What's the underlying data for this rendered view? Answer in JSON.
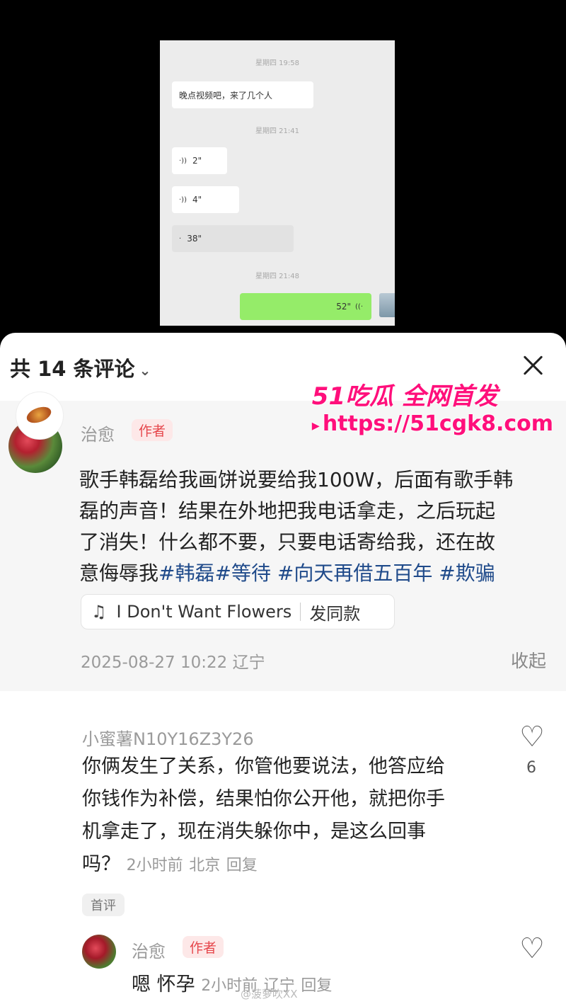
{
  "chat_screenshot": {
    "timestamps": [
      "星期四 19:58",
      "星期四 21:41",
      "星期四 21:48"
    ],
    "messages": [
      {
        "type": "text",
        "direction": "in",
        "text": "晚点视频吧，来了几个人"
      },
      {
        "type": "voice",
        "direction": "in",
        "duration": "2\""
      },
      {
        "type": "voice",
        "direction": "in",
        "duration": "4\""
      },
      {
        "type": "voice",
        "direction": "in",
        "duration": "38\""
      },
      {
        "type": "voice",
        "direction": "out",
        "duration": "52\""
      }
    ]
  },
  "header": {
    "title": "共 14 条评论",
    "chevron": "chevron-down-icon",
    "close": "close-icon"
  },
  "main_comment": {
    "username": "治愈",
    "author_tag": "作者",
    "text_lines": [
      "歌手韩磊给我画饼说要给我100W，后面有歌手韩",
      "磊的声音！结果在外地把我电话拿走，之后玩起",
      "了消失！什么都不要，只要电话寄给我，还在故",
      "意侮辱我"
    ],
    "hashtags": [
      "#韩磊",
      "#等待",
      "#向天再借五百年",
      "#欺骗"
    ],
    "music": {
      "icon": "music-note-icon",
      "title": "I Don't Want Flowers",
      "action": "发同款"
    },
    "datetime": "2025-08-27 10:22",
    "location": "辽宁",
    "collapse_label": "收起"
  },
  "reply_comment": {
    "username": "小蜜薯N10Y16Z3Y26",
    "text_lines": [
      "你俩发生了关系，你管他要说法，他答应给",
      "你钱作为补偿，结果怕你公开他，就把你手",
      "机拿走了，现在消失躲你中，是这么回事",
      "吗？"
    ],
    "time": "2小时前",
    "location": "北京",
    "reply_label": "回复",
    "likes": "6",
    "badge": "首评"
  },
  "sub_reply": {
    "username": "治愈",
    "author_tag": "作者",
    "text": "嗯 怀孕",
    "time": "2小时前",
    "location": "辽宁",
    "reply_label": "回复"
  },
  "watermark": {
    "line1": "51吃瓜 全网首发",
    "line2": "https://51cgk8.com",
    "bottom": "@菠萝吹XX"
  }
}
